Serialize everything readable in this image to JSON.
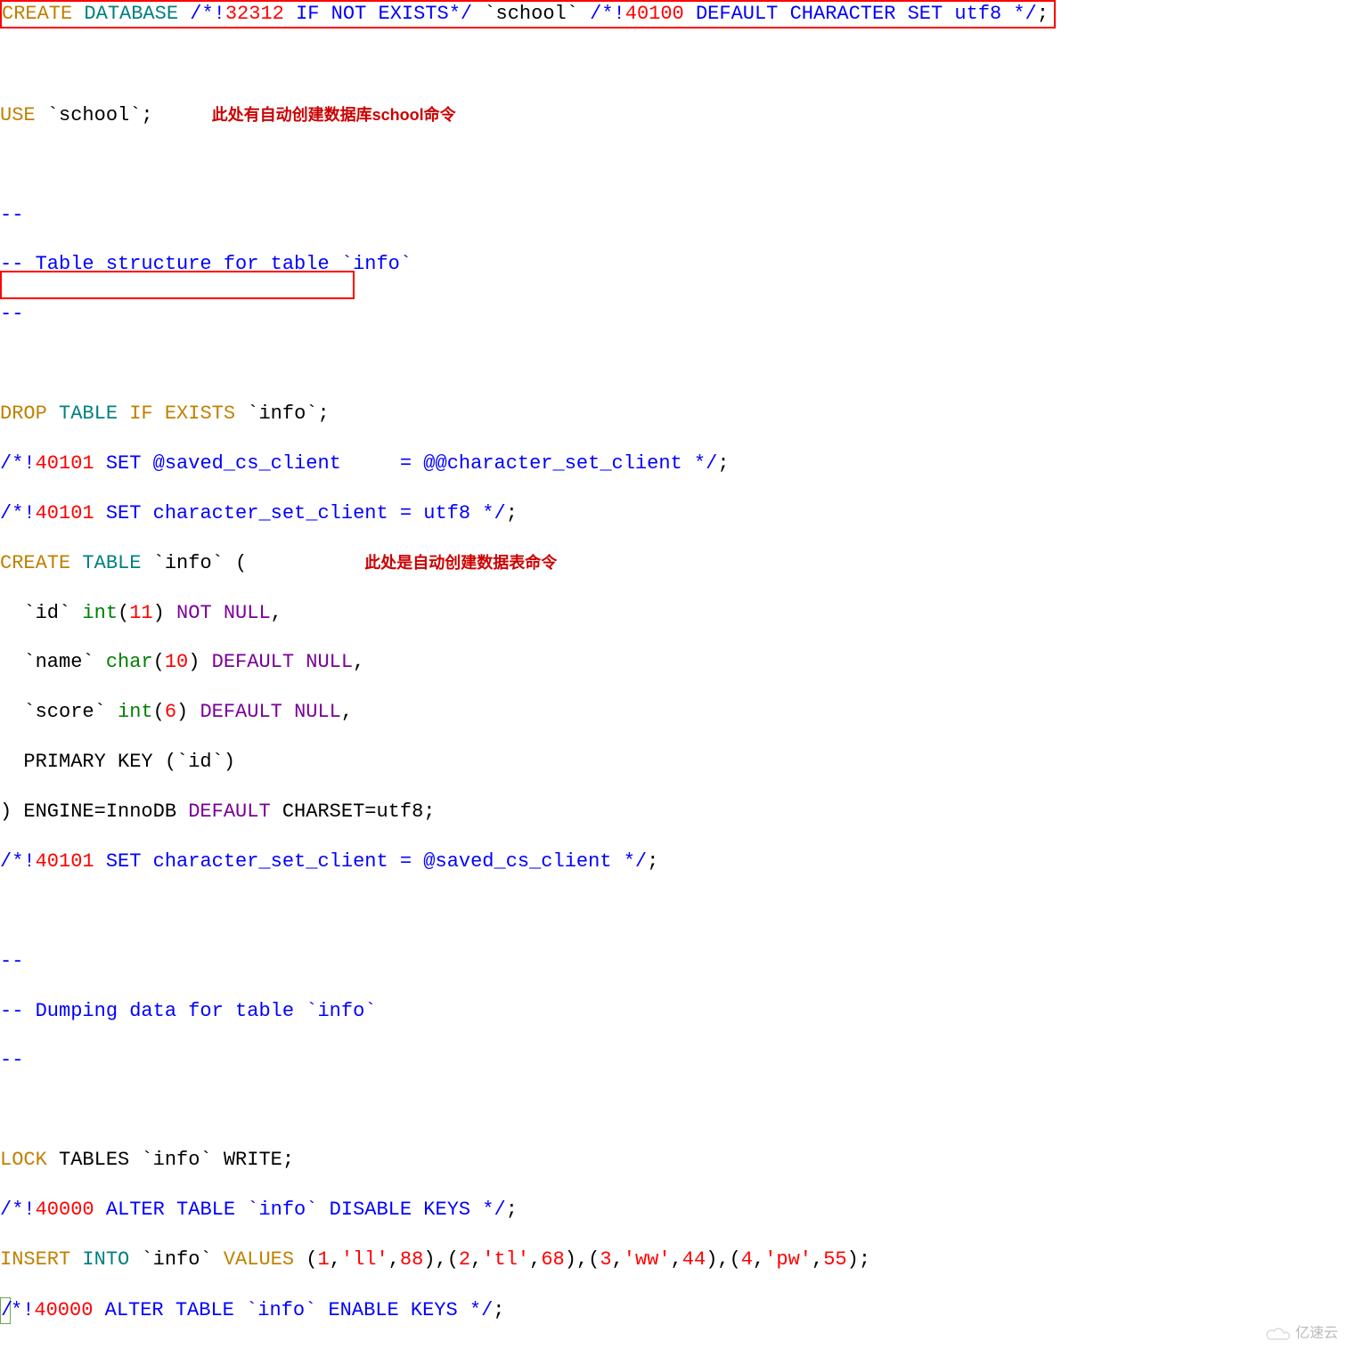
{
  "sql": {
    "line1": {
      "create": "CREATE",
      "database": "DATABASE",
      "c1a": "/*!",
      "c1num": "32312",
      "c1b": " IF NOT EXISTS*/",
      "schoolTick": " `school` ",
      "c2a": "/*!",
      "c2num": "40100",
      "c2b": " DEFAULT CHARACTER SET utf8 */",
      "semi": ";"
    },
    "line3": {
      "use": "USE",
      "tail": " `school`;"
    },
    "annotation1": "此处有自动创建数据库school命令",
    "line5a": "--",
    "line5b": "-- Table structure for table `info`",
    "line5c": "--",
    "line7": {
      "drop": "DROP",
      "table": "TABLE",
      "if": "IF",
      "exists": "EXISTS",
      "tail": " `info`;"
    },
    "line8": {
      "a": "/*!",
      "n": "40101",
      "b": " SET @saved_cs_client     = @@character_set_client */",
      "semi": ";"
    },
    "line9": {
      "a": "/*!",
      "n": "40101",
      "b": " SET character_set_client = utf8 */",
      "semi": ";"
    },
    "line10": {
      "create": "CREATE",
      "table": "TABLE",
      "tail": " `info` ("
    },
    "annotation2": "此处是自动创建数据表命令",
    "line11": {
      "pre": "  `id` ",
      "int": "int",
      "par": "(",
      "n": "11",
      "par2": ") ",
      "not": "NOT",
      "sp": " ",
      "null": "NULL",
      "tail": ","
    },
    "line12": {
      "pre": "  `name` ",
      "char": "char",
      "par": "(",
      "n": "10",
      "par2": ") ",
      "def": "DEFAULT",
      "sp": " ",
      "null": "NULL",
      "tail": ","
    },
    "line13": {
      "pre": "  `score` ",
      "int": "int",
      "par": "(",
      "n": "6",
      "par2": ") ",
      "def": "DEFAULT",
      "sp": " ",
      "null": "NULL",
      "tail": ","
    },
    "line14": "  PRIMARY KEY (`id`)",
    "line15": {
      "pre": ") ENGINE=InnoDB ",
      "def": "DEFAULT",
      "tail": " CHARSET=utf8;"
    },
    "line16": {
      "a": "/*!",
      "n": "40101",
      "b": " SET character_set_client = @saved_cs_client */",
      "semi": ";"
    },
    "line18a": "--",
    "line18b": "-- Dumping data for table `info`",
    "line18c": "--",
    "line20": {
      "lock": "LOCK",
      "tail": " TABLES `info` WRITE;"
    },
    "line21": {
      "a": "/*!",
      "n": "40000",
      "b": " ALTER TABLE `info` DISABLE KEYS */",
      "semi": ";"
    },
    "line22": {
      "insert": "INSERT",
      "into": "INTO",
      "mid": " `info` ",
      "values": "VALUES",
      "sp": " ",
      "p": "(",
      "v1n": "1",
      "c": ",",
      "v1s": "'ll'",
      "v1b": "88",
      "v2n": "2",
      "v2s": "'tl'",
      "v2b": "68",
      "v3n": "3",
      "v3s": "'ww'",
      "v3b": "44",
      "v4n": "4",
      "v4s": "'pw'",
      "v4b": "55",
      "cp": ")",
      "semi": ";"
    },
    "line23": {
      "slash": "/",
      "a": "*!",
      "n": "40000",
      "b": " ALTER TABLE `info` ENABLE KEYS */",
      "semi": ";"
    }
  },
  "watermark": "亿速云"
}
